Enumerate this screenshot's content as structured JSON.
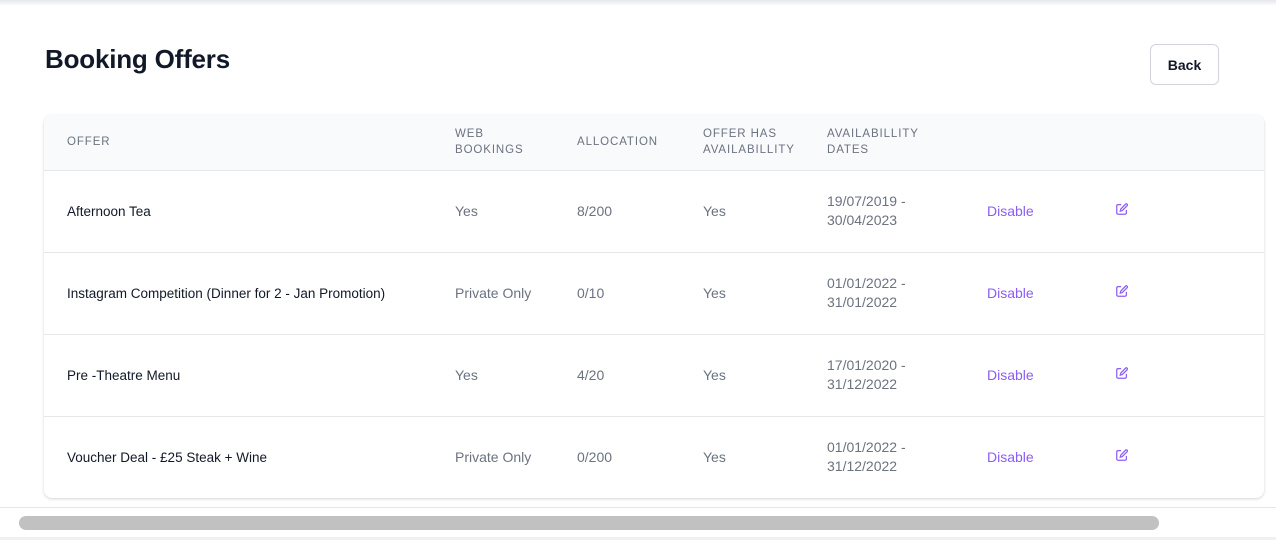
{
  "page": {
    "title": "Booking Offers",
    "back_label": "Back"
  },
  "table": {
    "headers": {
      "offer": "OFFER",
      "web_bookings_1": "WEB",
      "web_bookings_2": "BOOKINGS",
      "allocation": "ALLOCATION",
      "availability_1": "OFFER HAS",
      "availability_2": "AVAILABILLITY",
      "dates_1": "AVAILABILLITY",
      "dates_2": "DATES"
    },
    "rows": [
      {
        "offer": "Afternoon Tea",
        "web_bookings": "Yes",
        "allocation": "8/200",
        "has_availability": "Yes",
        "date_start": "19/07/2019 -",
        "date_end": "30/04/2023",
        "action": "Disable",
        "edit_icon": "edit-icon"
      },
      {
        "offer": "Instagram Competition (Dinner for 2 - Jan Promotion)",
        "web_bookings": "Private Only",
        "allocation": "0/10",
        "has_availability": "Yes",
        "date_start": "01/01/2022 -",
        "date_end": "31/01/2022",
        "action": "Disable",
        "edit_icon": "edit-icon"
      },
      {
        "offer": "Pre -Theatre Menu",
        "web_bookings": "Yes",
        "allocation": "4/20",
        "has_availability": "Yes",
        "date_start": "17/01/2020 -",
        "date_end": "31/12/2022",
        "action": "Disable",
        "edit_icon": "edit-icon"
      },
      {
        "offer": "Voucher Deal - £25 Steak + Wine",
        "web_bookings": "Private Only",
        "allocation": "0/200",
        "has_availability": "Yes",
        "date_start": "01/01/2022 -",
        "date_end": "31/12/2022",
        "action": "Disable",
        "edit_icon": "edit-icon"
      }
    ]
  },
  "colors": {
    "accent": "#8b5cf6",
    "heading": "#111827",
    "muted": "#6b7280",
    "header_bg": "#f9fafb"
  }
}
